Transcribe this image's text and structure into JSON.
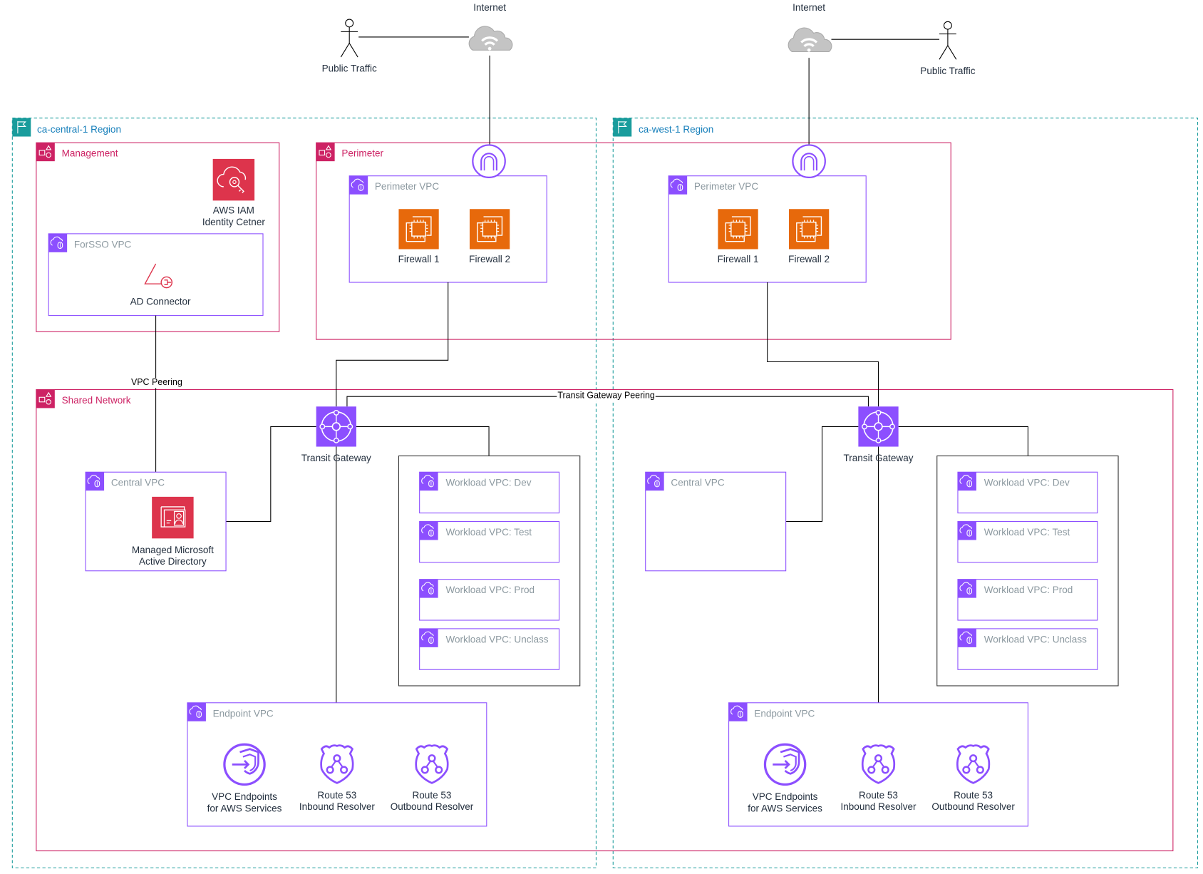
{
  "colors": {
    "region": "#1a9c9c",
    "account": "#cd2264",
    "vpc": "#8c4fff",
    "firewall": "#e7690b",
    "security": "#dd344c",
    "internet": "#b8b8b8",
    "line": "#000000"
  },
  "external": {
    "central": {
      "internet_label": "Internet",
      "actor_label": "Public Traffic"
    },
    "west": {
      "internet_label": "Internet",
      "actor_label": "Public Traffic"
    }
  },
  "regions": {
    "central": {
      "title": "ca-central-1 Region",
      "icon": "region-flag-icon",
      "management": {
        "title": "Management",
        "iam": {
          "label_1": "AWS IAM",
          "label_2": "Identity Cetner",
          "icon": "iam-identity-center-icon"
        },
        "forsso_vpc": {
          "title": "ForSSO VPC",
          "ad_connector": {
            "label": "AD Connector",
            "icon": "ad-connector-icon"
          }
        }
      },
      "perimeter": {
        "title": "Perimeter",
        "vpc_title": "Perimeter VPC",
        "igw_icon": "internet-gateway-icon",
        "firewalls": [
          "Firewall 1",
          "Firewall 2"
        ]
      },
      "shared": {
        "title": "Shared Network",
        "central_vpc": {
          "title": "Central VPC",
          "ad": {
            "label_1": "Managed Microsoft",
            "label_2": "Active Directory"
          }
        },
        "tgw_label": "Transit Gateway",
        "workloads": [
          "Workload VPC: Dev",
          "Workload VPC: Test",
          "Workload VPC: Prod",
          "Workload VPC: Unclass"
        ],
        "endpoint_vpc": {
          "title": "Endpoint VPC",
          "services": [
            {
              "label_1": "VPC Endpoints",
              "label_2": "for AWS Services",
              "icon": "vpc-endpoints-icon"
            },
            {
              "label_1": "Route 53",
              "label_2": "Inbound Resolver",
              "icon": "route53-resolver-icon"
            },
            {
              "label_1": "Route 53",
              "label_2": "Outbound Resolver",
              "icon": "route53-resolver-icon"
            }
          ]
        }
      }
    },
    "west": {
      "title": "ca-west-1 Region",
      "icon": "region-flag-icon",
      "perimeter": {
        "vpc_title": "Perimeter VPC",
        "igw_icon": "internet-gateway-icon",
        "firewalls": [
          "Firewall 1",
          "Firewall 2"
        ]
      },
      "shared": {
        "central_vpc": {
          "title": "Central VPC"
        },
        "tgw_label": "Transit Gateway",
        "workloads": [
          "Workload VPC: Dev",
          "Workload VPC: Test",
          "Workload VPC: Prod",
          "Workload VPC: Unclass"
        ],
        "endpoint_vpc": {
          "title": "Endpoint VPC",
          "services": [
            {
              "label_1": "VPC Endpoints",
              "label_2": "for AWS Services"
            },
            {
              "label_1": "Route 53",
              "label_2": "Inbound Resolver"
            },
            {
              "label_1": "Route 53",
              "label_2": "Outbound Resolver"
            }
          ]
        }
      }
    }
  },
  "edges": {
    "vpc_peering": "VPC Peering",
    "tgw_peering": "Transit Gateway Peering"
  }
}
